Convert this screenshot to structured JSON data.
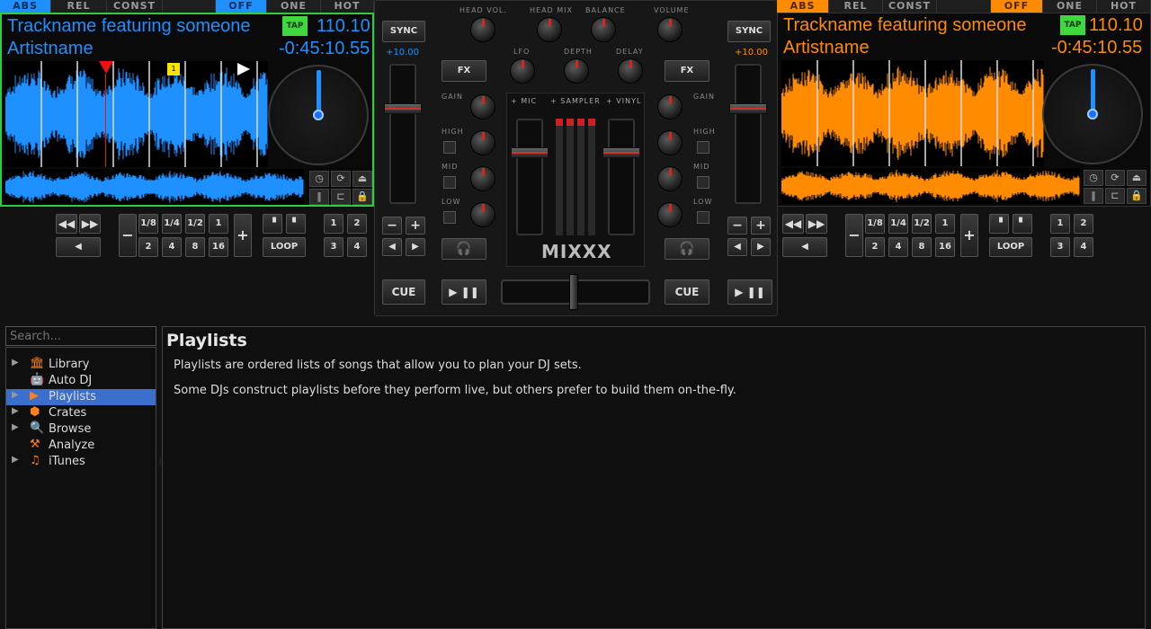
{
  "colors": {
    "deck1_accent": "#1e90ff",
    "deck2_accent": "#ff8c00",
    "tap_green": "#3fd83f",
    "selection_blue": "#3b6fce",
    "nav_icon_orange": "#ff7f1a"
  },
  "deck1": {
    "modes": [
      "ABS",
      "REL",
      "CONST"
    ],
    "hotcue_modes": [
      "OFF",
      "ONE",
      "HOT"
    ],
    "title": "Trackname featuring someone",
    "artist": "Artistname",
    "bpm": "110.10",
    "time": "-0:45:10.55",
    "tap": "TAP",
    "sync": "SYNC",
    "pitch": "+10.00",
    "fx": "FX",
    "cue": "CUE",
    "loop": "LOOP",
    "beat_sizes_top": [
      "1/8",
      "1/4",
      "1/2",
      "1"
    ],
    "beat_sizes_bottom": [
      "2",
      "4",
      "8",
      "16"
    ],
    "hotcues": [
      "1",
      "2",
      "3",
      "4"
    ],
    "cue_marker": "1"
  },
  "deck2": {
    "modes": [
      "ABS",
      "REL",
      "CONST"
    ],
    "hotcue_modes": [
      "OFF",
      "ONE",
      "HOT"
    ],
    "title": "Trackname featuring someone",
    "artist": "Artistname",
    "bpm": "110.10",
    "time": "-0:45:10.55",
    "tap": "TAP",
    "sync": "SYNC",
    "pitch": "+10.00",
    "fx": "FX",
    "cue": "CUE",
    "loop": "LOOP",
    "beat_sizes_top": [
      "1/8",
      "1/4",
      "1/2",
      "1"
    ],
    "beat_sizes_bottom": [
      "2",
      "4",
      "8",
      "16"
    ],
    "hotcues": [
      "1",
      "2",
      "3",
      "4"
    ]
  },
  "mixer": {
    "top_knobs": [
      "HEAD VOL.",
      "HEAD MIX",
      "BALANCE",
      "VOLUME"
    ],
    "fx_knobs": [
      "LFO",
      "DEPTH",
      "DELAY"
    ],
    "eq_labels": [
      "GAIN",
      "HIGH",
      "MID",
      "LOW"
    ],
    "sources": [
      "+ MIC",
      "+ SAMPLER",
      "+ VINYL"
    ],
    "logo": "MIXXX"
  },
  "library": {
    "search_placeholder": "Search...",
    "nav": [
      {
        "label": "Library",
        "icon": "library-icon",
        "glyph": "🏛",
        "has_arrow": true
      },
      {
        "label": "Auto DJ",
        "icon": "autodj-icon",
        "glyph": "🤖",
        "has_arrow": false
      },
      {
        "label": "Playlists",
        "icon": "playlist-icon",
        "glyph": "▶",
        "has_arrow": true,
        "selected": true
      },
      {
        "label": "Crates",
        "icon": "crate-icon",
        "glyph": "⬢",
        "has_arrow": true
      },
      {
        "label": "Browse",
        "icon": "browse-icon",
        "glyph": "🔍",
        "has_arrow": true
      },
      {
        "label": "Analyze",
        "icon": "analyze-icon",
        "glyph": "⚒",
        "has_arrow": false
      },
      {
        "label": "iTunes",
        "icon": "itunes-icon",
        "glyph": "♫",
        "has_arrow": true
      }
    ],
    "title": "Playlists",
    "paragraphs": [
      "Playlists are ordered lists of songs that allow you to plan your DJ sets.",
      "Some DJs construct playlists before they perform live, but others prefer to build them on-the-fly."
    ]
  }
}
